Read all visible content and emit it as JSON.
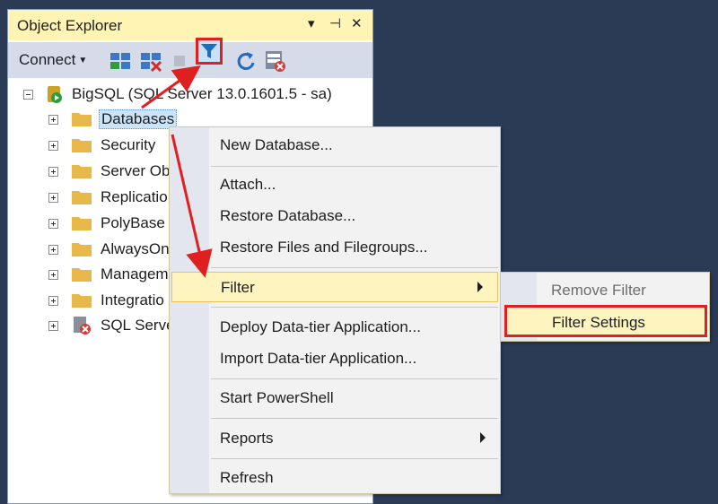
{
  "panel": {
    "title": "Object Explorer",
    "title_buttons": [
      "▾",
      "⊣",
      "✕"
    ]
  },
  "toolbar": {
    "connect_label": "Connect",
    "icons": [
      "connect-object-explorer-icon",
      "disconnect-icon",
      "stop-icon",
      "filter-icon",
      "refresh-icon",
      "activity-monitor-icon"
    ]
  },
  "tree": {
    "server": "BigSQL (SQL Server 13.0.1601.5 - sa)",
    "children": [
      "Databases",
      "Security",
      "Server Ob",
      "Replicatio",
      "PolyBase",
      "AlwaysOn",
      "Managem",
      "Integratio",
      "SQL Serve"
    ]
  },
  "context_menu": {
    "items": [
      "New Database...",
      "Attach...",
      "Restore Database...",
      "Restore Files and Filegroups...",
      "Filter",
      "Deploy Data-tier Application...",
      "Import Data-tier Application...",
      "Start PowerShell",
      "Reports",
      "Refresh"
    ]
  },
  "submenu": {
    "remove_filter": "Remove Filter",
    "filter_settings": "Filter Settings"
  },
  "colors": {
    "title_bar": "#fff4b3",
    "toolbar": "#d6dbe9",
    "highlight_border": "#e02020",
    "menu_hover": "#fdf4bf",
    "background": "#2b3a55"
  }
}
